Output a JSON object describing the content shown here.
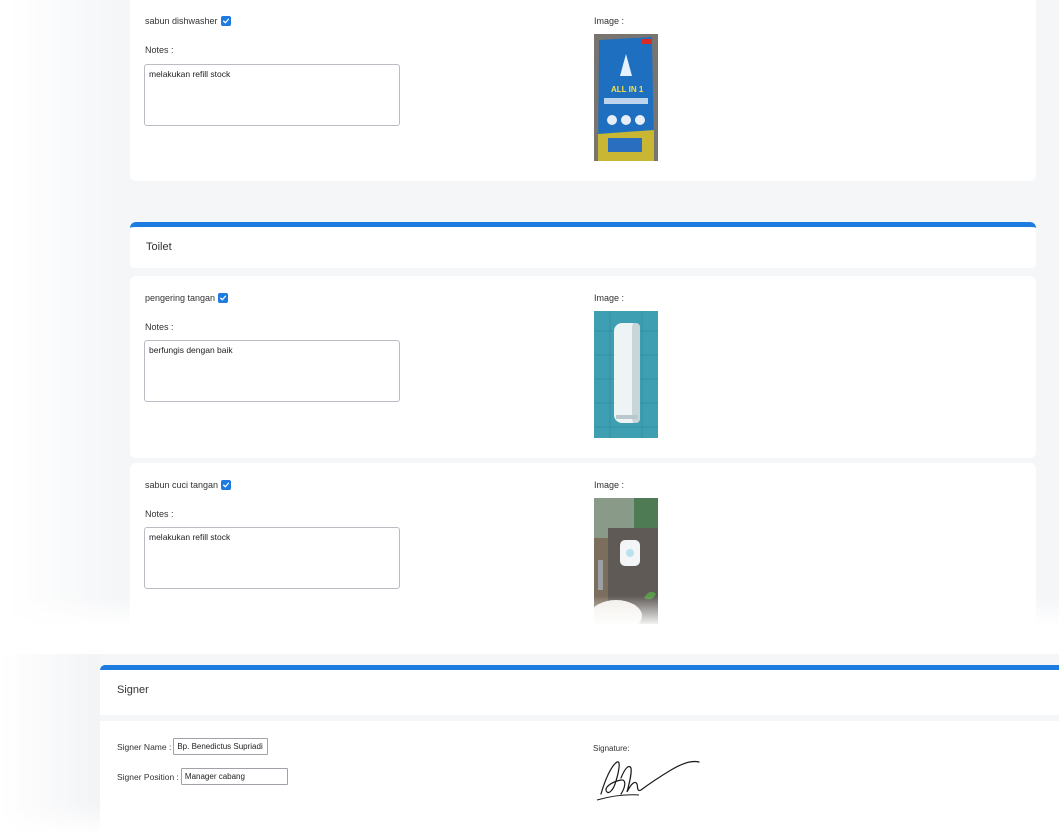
{
  "items_top": [
    {
      "label": "sabun dishwasher",
      "checked": true,
      "notes_label": "Notes :",
      "notes_value": "melakukan refill stock",
      "image_label": "Image :",
      "image_icon": "dishwasher-soap-package-photo"
    }
  ],
  "section_toilet": {
    "title": "Toilet",
    "accent_color": "#1e7be0",
    "items": [
      {
        "label": "pengering tangan",
        "checked": true,
        "notes_label": "Notes :",
        "notes_value": "berfungis dengan baik",
        "image_label": "Image :",
        "image_icon": "hand-dryer-photo"
      },
      {
        "label": "sabun cuci tangan",
        "checked": true,
        "notes_label": "Notes :",
        "notes_value": "melakukan refill stock",
        "image_label": "Image :",
        "image_icon": "hand-soap-dispenser-photo"
      }
    ]
  },
  "signer": {
    "title": "Signer",
    "name_label": "Signer Name :",
    "name_value": "Bp. Benedictus Supriadi",
    "position_label": "Signer Position :",
    "position_value": "Manager cabang",
    "signature_label": "Signature:",
    "signature_icon": "handwritten-signature"
  }
}
